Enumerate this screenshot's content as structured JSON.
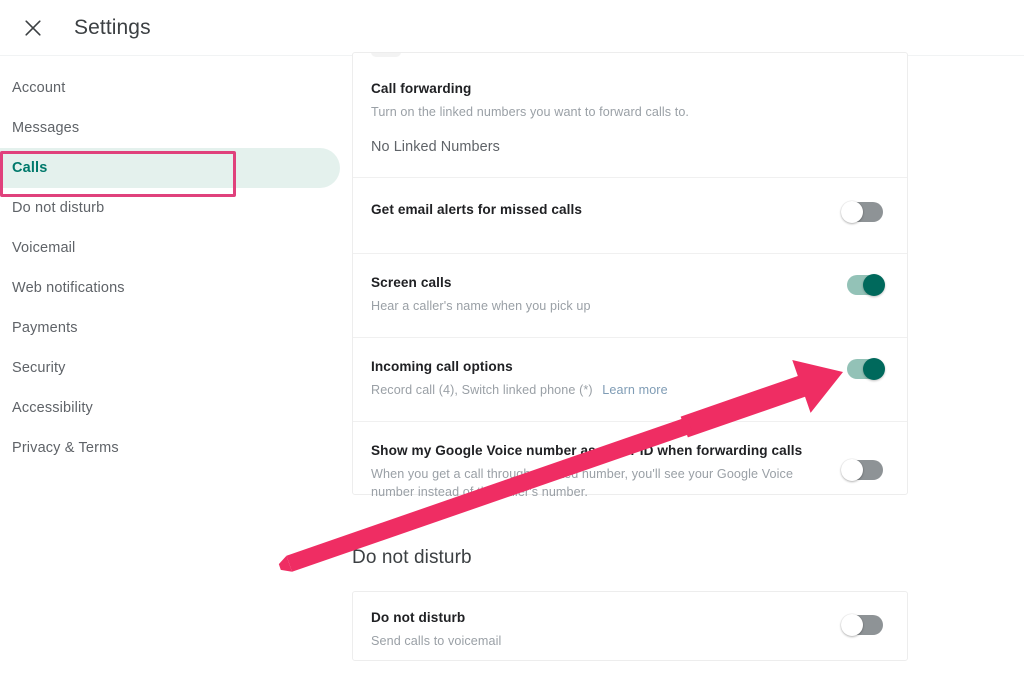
{
  "header": {
    "title": "Settings",
    "close_icon": "close-icon"
  },
  "sidebar": {
    "items": [
      {
        "label": "Account",
        "active": false
      },
      {
        "label": "Messages",
        "active": false
      },
      {
        "label": "Calls",
        "active": true
      },
      {
        "label": "Do not disturb",
        "active": false
      },
      {
        "label": "Voicemail",
        "active": false
      },
      {
        "label": "Web notifications",
        "active": false
      },
      {
        "label": "Payments",
        "active": false
      },
      {
        "label": "Security",
        "active": false
      },
      {
        "label": "Accessibility",
        "active": false
      },
      {
        "label": "Privacy & Terms",
        "active": false
      }
    ]
  },
  "calls_card": {
    "rows": [
      {
        "name": "call-forwarding",
        "title": "Call forwarding",
        "subtitle": "Turn on the linked numbers you want to forward calls to.",
        "value": "No Linked Numbers",
        "toggle": null
      },
      {
        "name": "email-alerts",
        "title": "Get email alerts for missed calls",
        "subtitle": "",
        "value": "",
        "toggle": "off"
      },
      {
        "name": "screen-calls",
        "title": "Screen calls",
        "subtitle": "Hear a caller's name when you pick up",
        "value": "",
        "toggle": "on"
      },
      {
        "name": "incoming-call-options",
        "title": "Incoming call options",
        "subtitle": "Record call (4), Switch linked phone (*)",
        "link": "Learn more",
        "value": "",
        "toggle": "on"
      },
      {
        "name": "show-caller-id",
        "title": "Show my Google Voice number as caller ID when forwarding calls",
        "subtitle": "When you get a call through a linked number, you'll see your Google Voice number instead of the caller's number.",
        "value": "",
        "toggle": "off"
      }
    ]
  },
  "dnd_section": {
    "heading": "Do not disturb",
    "row": {
      "title": "Do not disturb",
      "subtitle": "Send calls to voicemail",
      "toggle": "off"
    }
  },
  "annotation": {
    "highlight_color": "#e0417c",
    "arrow_color": "#ef2d63",
    "arrow_target": "incoming-call-options-toggle",
    "highlight_target": "sidebar-item-calls"
  },
  "colors": {
    "accent_teal": "#00695c",
    "active_bg": "#e4f1ed",
    "toggle_off": "#8e9396",
    "link": "#7f9cb5"
  }
}
